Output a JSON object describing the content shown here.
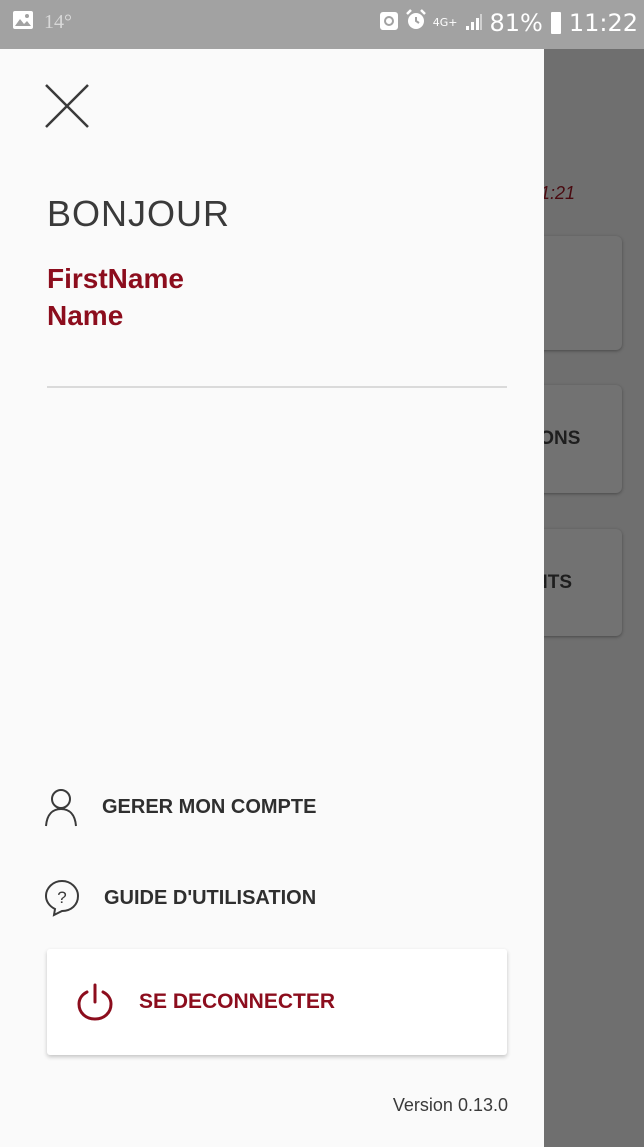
{
  "status_bar": {
    "temperature": "14°",
    "network": "4G+",
    "battery": "81%",
    "time": "11:22"
  },
  "background_app": {
    "time_fragment": "1:21",
    "card_labels": [
      "",
      "IONS",
      "NTS"
    ]
  },
  "drawer": {
    "greeting": "BONJOUR",
    "first_name": "FirstName",
    "last_name": "Name",
    "menu": [
      {
        "label": "GERER MON COMPTE",
        "icon": "user-icon"
      },
      {
        "label": "GUIDE D'UTILISATION",
        "icon": "help-bubble-icon"
      }
    ],
    "logout_label": "SE DECONNECTER",
    "version": "Version 0.13.0"
  },
  "colors": {
    "accent": "#8c0d1d",
    "drawer_bg": "#fafafa",
    "scrim": "#6b6b6b"
  }
}
